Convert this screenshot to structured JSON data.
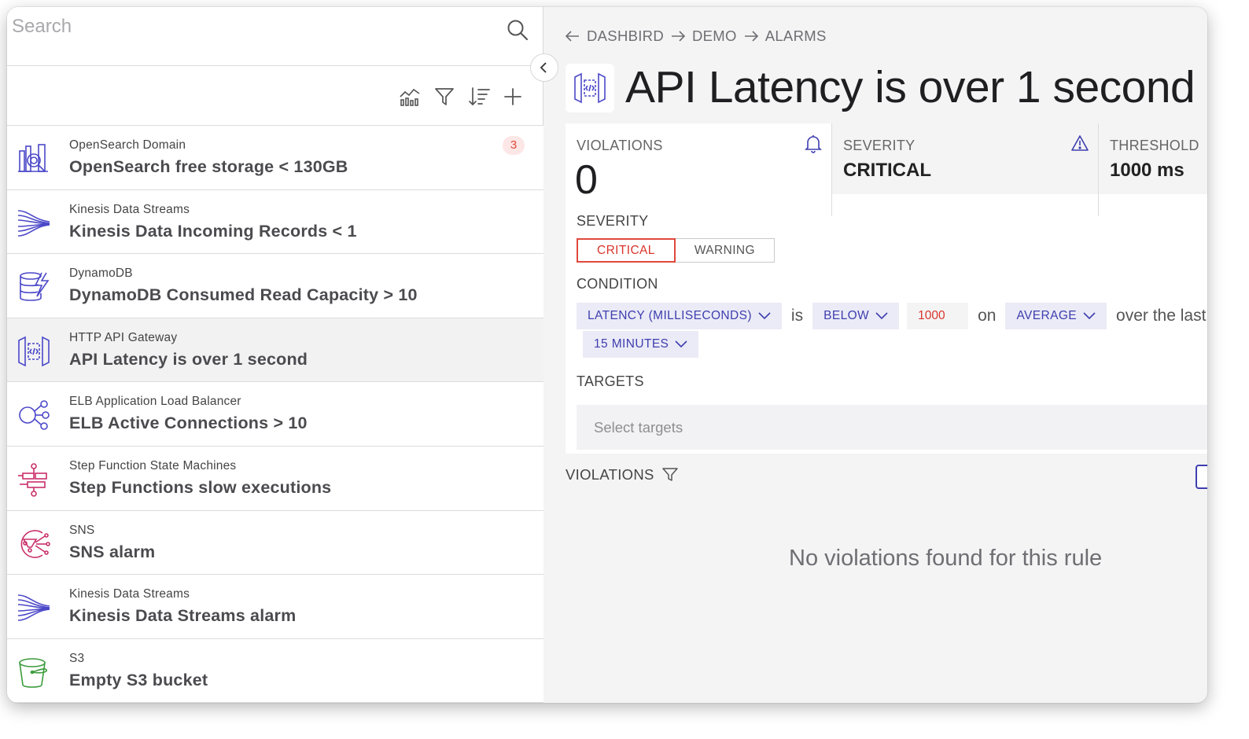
{
  "search": {
    "placeholder": "Search"
  },
  "toolbar": {
    "icons": [
      "chart-icon",
      "filter-icon",
      "sort-icon",
      "add-icon"
    ]
  },
  "alarms": [
    {
      "service": "OpenSearch Domain",
      "title": "OpenSearch free storage < 130GB",
      "badge": "3",
      "icon": "opensearch-icon",
      "color": "#4b48c8"
    },
    {
      "service": "Kinesis Data Streams",
      "title": "Kinesis Data Incoming Records < 1",
      "icon": "kinesis-icon",
      "color": "#4b48c8"
    },
    {
      "service": "DynamoDB",
      "title": "DynamoDB Consumed Read Capacity > 10",
      "icon": "dynamodb-icon",
      "color": "#4b48c8"
    },
    {
      "service": "HTTP API Gateway",
      "title": "API Latency is over 1 second",
      "icon": "api-gateway-icon",
      "color": "#4b48c8",
      "selected": true
    },
    {
      "service": "ELB Application Load Balancer",
      "title": "ELB Active Connections > 10",
      "icon": "elb-icon",
      "color": "#4b48c8"
    },
    {
      "service": "Step Function State Machines",
      "title": "Step Functions slow executions",
      "icon": "step-functions-icon",
      "color": "#c9306a"
    },
    {
      "service": "SNS",
      "title": "SNS alarm",
      "icon": "sns-icon",
      "color": "#c9306a"
    },
    {
      "service": "Kinesis Data Streams",
      "title": "Kinesis Data Streams alarm",
      "icon": "kinesis-icon",
      "color": "#4b48c8"
    },
    {
      "service": "S3",
      "title": "Empty S3 bucket",
      "icon": "s3-icon",
      "color": "#3b9b3b"
    }
  ],
  "breadcrumb": [
    "DASHBIRD",
    "DEMO",
    "ALARMS"
  ],
  "page": {
    "title": "API Latency is over 1 second"
  },
  "stats": {
    "violations_label": "VIOLATIONS",
    "violations_value": "0",
    "severity_label": "SEVERITY",
    "severity_value": "CRITICAL",
    "threshold_label": "THRESHOLD",
    "threshold_value": "1000 ms"
  },
  "form": {
    "severity_label": "SEVERITY",
    "severity_options": [
      "CRITICAL",
      "WARNING"
    ],
    "severity_selected": "CRITICAL",
    "condition_label": "CONDITION",
    "metric": "LATENCY (MILLISECONDS)",
    "word_is": "is",
    "comparison": "BELOW",
    "threshold": "1000",
    "word_on": "on",
    "aggregation": "AVERAGE",
    "word_over": "over the last",
    "period": "15 MINUTES",
    "targets_label": "TARGETS",
    "targets_placeholder": "Select targets"
  },
  "violations_section": {
    "label": "VIOLATIONS",
    "empty_message": "No violations found for this rule"
  },
  "colors": {
    "accent": "#3e3eb0",
    "critical": "#d9352b",
    "badge_bg": "#fde7e6"
  }
}
